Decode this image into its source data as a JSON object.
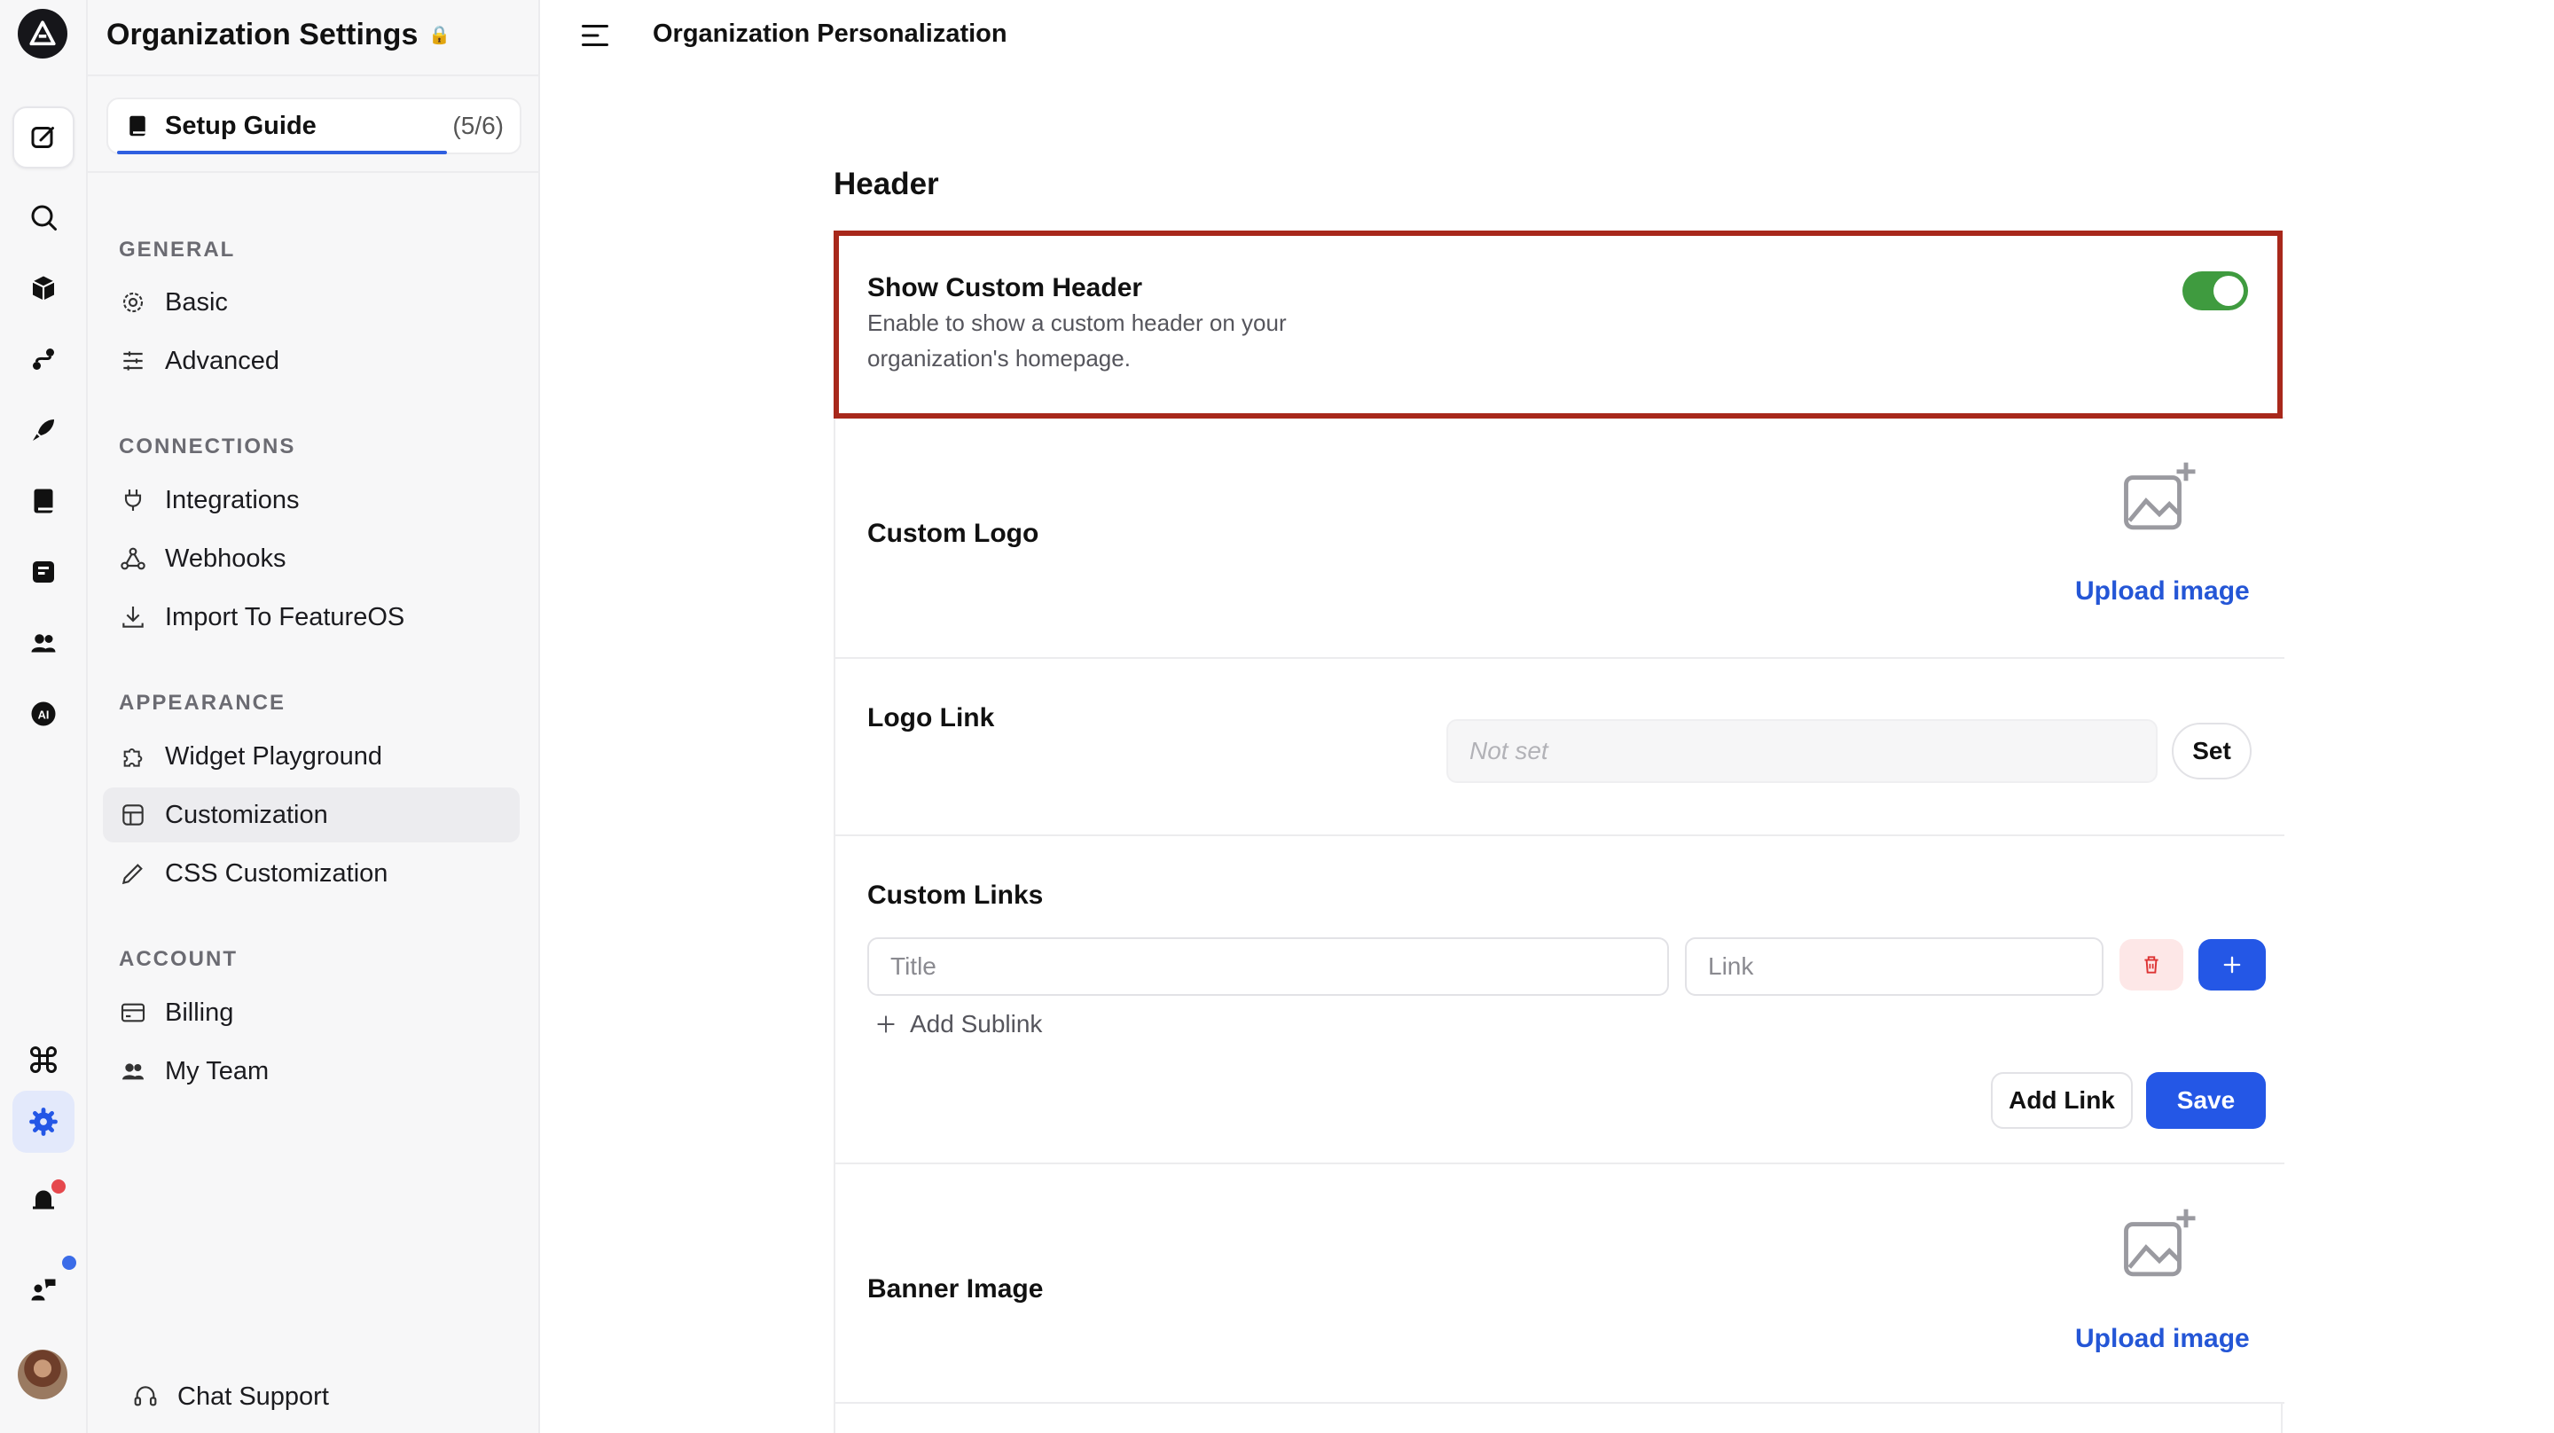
{
  "sidebar": {
    "title": "Organization Settings",
    "setup": {
      "label": "Setup Guide",
      "count": "(5/6)",
      "progress": 0.8333
    },
    "sections": {
      "general": "GENERAL",
      "connections": "CONNECTIONS",
      "appearance": "APPEARANCE",
      "account": "ACCOUNT"
    },
    "items": {
      "basic": "Basic",
      "advanced": "Advanced",
      "integrations": "Integrations",
      "webhooks": "Webhooks",
      "import": "Import To FeatureOS",
      "widget": "Widget Playground",
      "customization": "Customization",
      "css": "CSS Customization",
      "billing": "Billing",
      "team": "My Team"
    },
    "chat_support": "Chat Support"
  },
  "topbar": {
    "title": "Organization Personalization"
  },
  "content": {
    "section_title": "Header",
    "show_header": {
      "title": "Show Custom Header",
      "description": "Enable to show a custom header on your organization's homepage.",
      "enabled": true
    },
    "custom_logo": {
      "title": "Custom Logo",
      "upload": "Upload image"
    },
    "logo_link": {
      "title": "Logo Link",
      "placeholder": "Not set",
      "button": "Set"
    },
    "custom_links": {
      "title": "Custom Links",
      "title_placeholder": "Title",
      "link_placeholder": "Link",
      "add_sublink": "Add Sublink",
      "add_link": "Add Link",
      "save": "Save"
    },
    "banner_image": {
      "title": "Banner Image",
      "upload": "Upload image"
    }
  },
  "colors": {
    "accent": "#2457e6",
    "toggle_on": "#3f9b3f",
    "highlight_border": "#a8281b",
    "lock": "#e5484d"
  }
}
